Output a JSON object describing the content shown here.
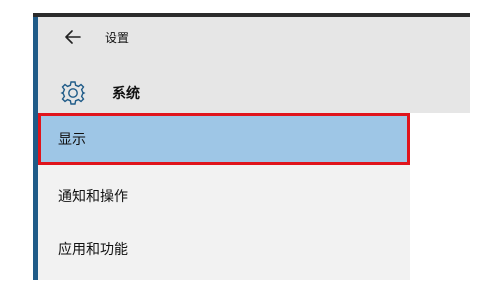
{
  "header": {
    "back_label": "设置",
    "title": "系统"
  },
  "sidebar": {
    "items": [
      {
        "label": "显示",
        "selected": true
      },
      {
        "label": "通知和操作",
        "selected": false
      },
      {
        "label": "应用和功能",
        "selected": false
      }
    ]
  },
  "colors": {
    "accent": "#1f5b88",
    "selection": "#9ec6e6",
    "highlight_border": "#e0141c"
  }
}
